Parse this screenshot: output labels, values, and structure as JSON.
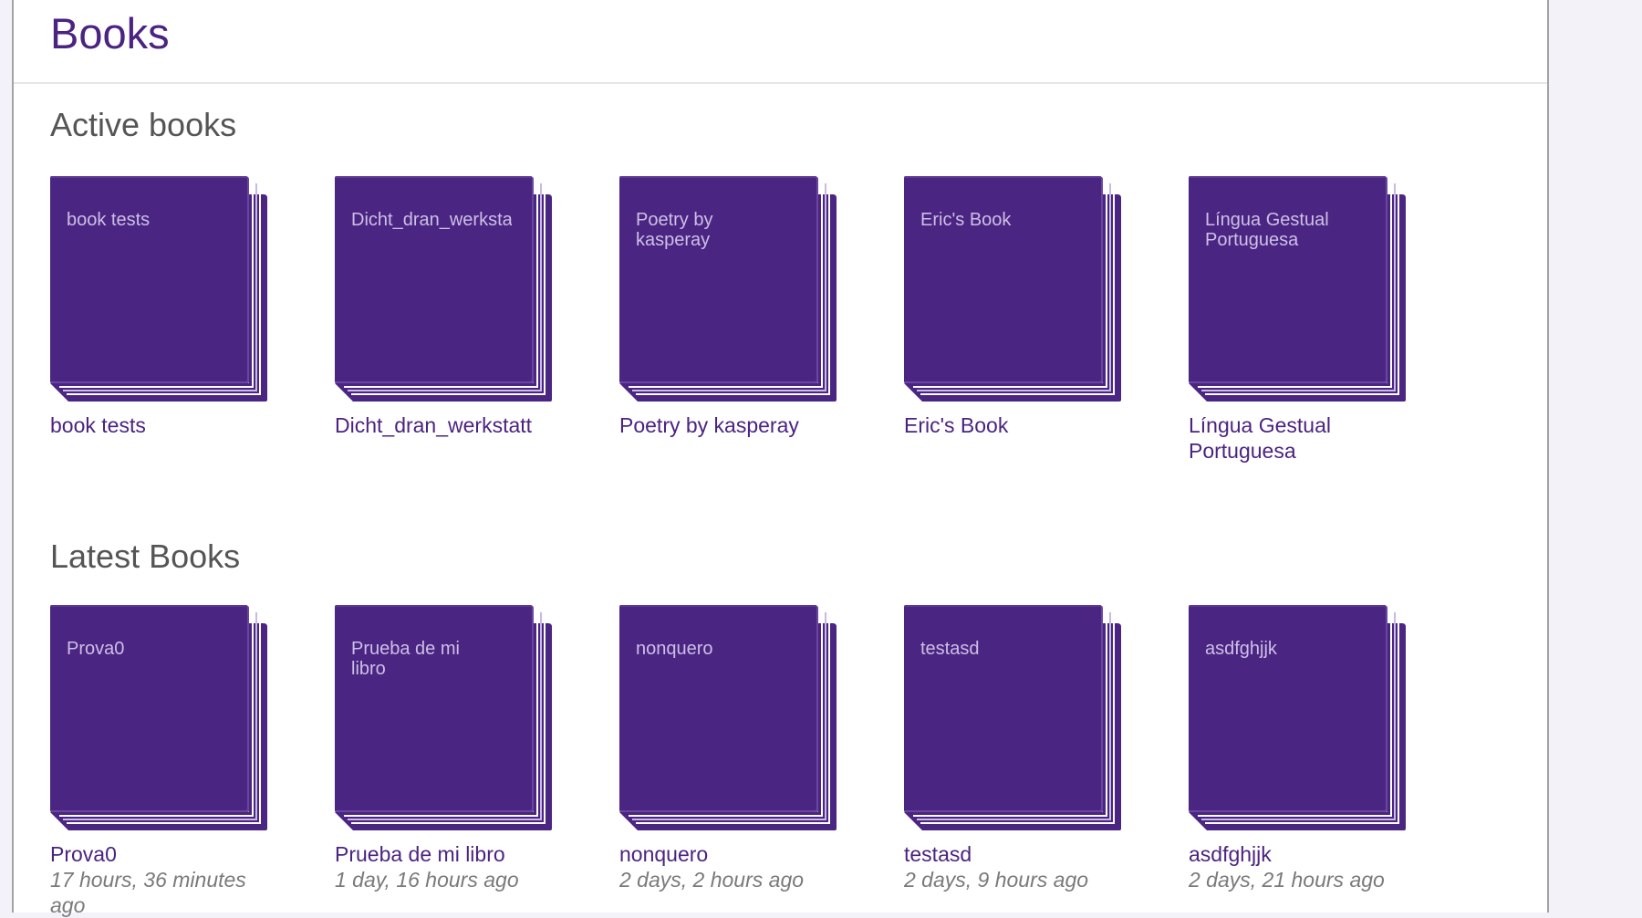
{
  "page": {
    "title": "Books"
  },
  "colors": {
    "accent": "#4b2380",
    "cover": "#4b2582",
    "cover_text": "#cdbfe6",
    "heading": "#555555",
    "timestamp": "#7a7a7a"
  },
  "active_books": {
    "heading": "Active books",
    "items": [
      {
        "cover_label": "book tests",
        "title": "book tests"
      },
      {
        "cover_label": "Dicht_dran_werkstatt",
        "title": "Dicht_dran_werkstatt"
      },
      {
        "cover_label": "Poetry by kasperay",
        "title": "Poetry by kasperay"
      },
      {
        "cover_label": "Eric's Book",
        "title": "Eric's Book"
      },
      {
        "cover_label": "Língua Gestual Portuguesa",
        "title": "Língua Gestual Portuguesa"
      }
    ]
  },
  "latest_books": {
    "heading": "Latest Books",
    "items": [
      {
        "cover_label": "Prova0",
        "title": "Prova0",
        "time": "17 hours, 36 minutes ago"
      },
      {
        "cover_label": "Prueba de mi libro",
        "title": "Prueba de mi libro",
        "time": "1 day, 16 hours ago"
      },
      {
        "cover_label": "nonquero",
        "title": "nonquero",
        "time": "2 days, 2 hours ago"
      },
      {
        "cover_label": "testasd",
        "title": "testasd",
        "time": "2 days, 9 hours ago"
      },
      {
        "cover_label": "asdfghjjk",
        "title": "asdfghjjk",
        "time": "2 days, 21 hours ago"
      }
    ]
  }
}
